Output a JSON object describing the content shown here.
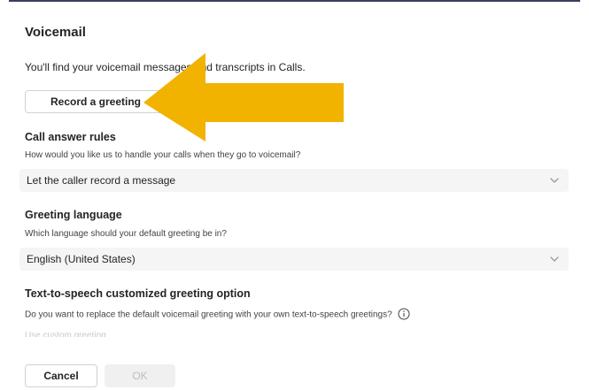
{
  "header": {
    "title": "Voicemail"
  },
  "intro_text": "You'll find your voicemail messages and transcripts in Calls.",
  "record_greeting_label": "Record a greeting",
  "call_answer_rules": {
    "title": "Call answer rules",
    "subtitle": "How would you like us to handle your calls when they go to voicemail?",
    "selected": "Let the caller record a message"
  },
  "greeting_language": {
    "title": "Greeting language",
    "subtitle": "Which language should your default greeting be in?",
    "selected": "English (United States)"
  },
  "tts_greeting": {
    "title": "Text-to-speech customized greeting option",
    "subtitle": "Do you want to replace the default voicemail greeting with your own text-to-speech greetings?",
    "faded_text": "Use custom greeting"
  },
  "footer": {
    "cancel_label": "Cancel",
    "ok_label": "OK"
  },
  "colors": {
    "annotation_arrow": "#F2B200",
    "top_rule": "#3B3F5C",
    "dropdown_bg": "#F5F5F5"
  },
  "icons": {
    "dropdown": "chevron-down-icon",
    "info": "info-icon",
    "annotation": "arrow-left-icon"
  }
}
